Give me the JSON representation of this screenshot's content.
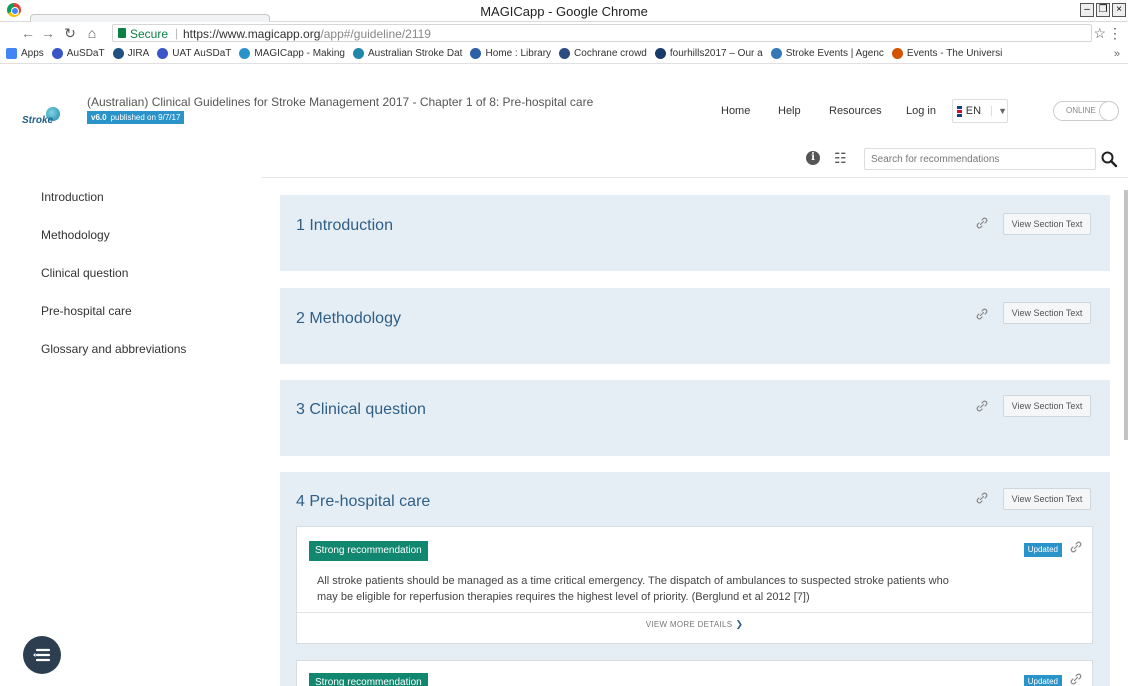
{
  "browser": {
    "window_title": "MAGICapp - Google Chrome",
    "secure_label": "Secure",
    "url_host": "https://www.magicapp.org",
    "url_rest": "/app#/guideline/2119",
    "bookmarks": [
      {
        "label": "Apps",
        "icon_color": "#4285f4"
      },
      {
        "label": "AuSDaT",
        "icon_color": "#3a55c7"
      },
      {
        "label": "JIRA",
        "icon_color": "#205081"
      },
      {
        "label": "UAT AuSDaT",
        "icon_color": "#3a55c7"
      },
      {
        "label": "MAGICapp - Making",
        "icon_color": "#2a93c9"
      },
      {
        "label": "Australian Stroke Dat",
        "icon_color": "#1f87a8"
      },
      {
        "label": "Home : Library",
        "icon_color": "#2d5fa6"
      },
      {
        "label": "Cochrane crowd",
        "icon_color": "#2b4c7e"
      },
      {
        "label": "fourhills2017 – Our a",
        "icon_color": "#1a3a6b"
      },
      {
        "label": "Stroke Events | Agenc",
        "icon_color": "#3478b5"
      },
      {
        "label": "Events - The Universi",
        "icon_color": "#d35400"
      }
    ]
  },
  "app": {
    "logo_text": "Stroke",
    "guideline_title": "(Australian) Clinical Guidelines for Stroke Management 2017 - Chapter 1 of 8: Pre-hospital care",
    "version": "v6.0",
    "published": "published on 9/7/17",
    "nav": {
      "home": "Home",
      "help": "Help",
      "resources": "Resources",
      "login": "Log in"
    },
    "language": "EN",
    "online_label": "ONLINE",
    "search_placeholder": "Search for recommendations"
  },
  "sidebar": {
    "items": [
      {
        "label": "Introduction"
      },
      {
        "label": "Methodology"
      },
      {
        "label": "Clinical question"
      },
      {
        "label": "Pre-hospital care"
      },
      {
        "label": "Glossary and abbreviations"
      }
    ]
  },
  "sections": [
    {
      "number": "1",
      "title": "Introduction",
      "button": "View Section Text"
    },
    {
      "number": "2",
      "title": "Methodology",
      "button": "View Section Text"
    },
    {
      "number": "3",
      "title": "Clinical question",
      "button": "View Section Text"
    },
    {
      "number": "4",
      "title": "Pre-hospital care",
      "button": "View Section Text"
    }
  ],
  "recommendations": [
    {
      "strength": "Strong recommendation",
      "status": "Updated",
      "text": "All stroke patients should be managed as a time critical emergency. The dispatch of ambulances to suspected stroke patients who may be eligible for reperfusion therapies requires the highest level of priority. (Berglund et al 2012 [7])",
      "more_details": "VIEW MORE DETAILS"
    },
    {
      "strength": "Strong recommendation",
      "status": "Updated"
    }
  ],
  "colors": {
    "section_bg": "#e6eef5",
    "section_title": "#2f5f86",
    "strong_badge": "#12876f",
    "updated_badge": "#2a93c9"
  }
}
